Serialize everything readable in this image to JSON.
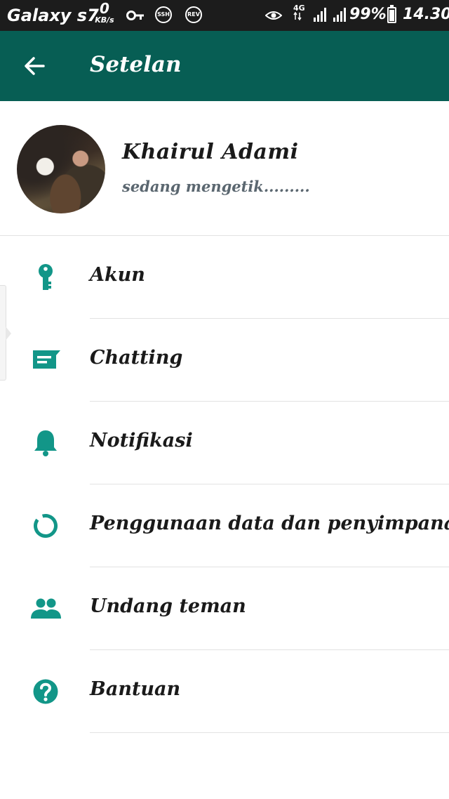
{
  "status_bar": {
    "device": "Galaxy s7",
    "speed_value": "0",
    "speed_unit": "KB/s",
    "badge_ssh": "SSH",
    "badge_rev": "REV",
    "network": "4G",
    "battery": "99%",
    "time": "14.30",
    "icons": [
      "key-icon",
      "ssh-icon",
      "rev-icon",
      "eye-icon",
      "signal-icon",
      "battery-icon"
    ]
  },
  "toolbar": {
    "title": "Setelan",
    "back_icon": "arrow-left-icon"
  },
  "profile": {
    "name": "Khairul Adami",
    "status": "sedang mengetik........."
  },
  "menu": {
    "items": [
      {
        "label": "Akun",
        "icon": "key-icon"
      },
      {
        "label": "Chatting",
        "icon": "chat-icon"
      },
      {
        "label": "Notifikasi",
        "icon": "bell-icon"
      },
      {
        "label": "Penggunaan data dan penyimpanan",
        "icon": "data-usage-icon"
      },
      {
        "label": "Undang teman",
        "icon": "people-icon"
      },
      {
        "label": "Bantuan",
        "icon": "help-icon"
      }
    ]
  },
  "colors": {
    "toolbar": "#075e54",
    "accent": "#129688",
    "status_bar": "#1c1c1c"
  }
}
